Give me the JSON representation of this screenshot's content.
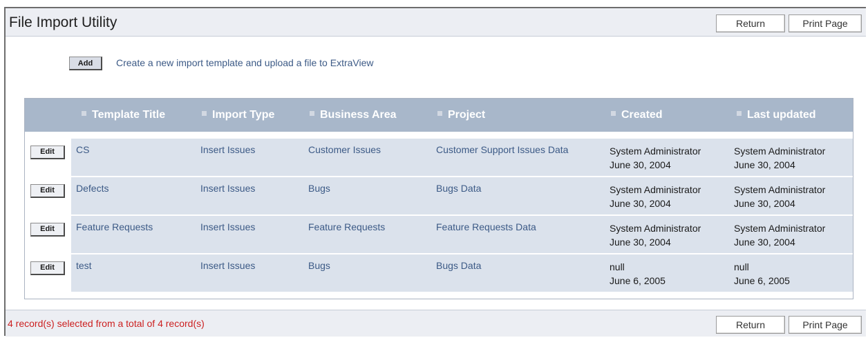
{
  "page": {
    "title": "File Import Utility",
    "return_label": "Return",
    "print_label": "Print Page"
  },
  "add": {
    "button_label": "Add",
    "description": "Create a new import template and upload a file to ExtraView"
  },
  "table": {
    "headers": [
      "Template Title",
      "Import Type",
      "Business Area",
      "Project",
      "Created",
      "Last updated"
    ],
    "edit_label": "Edit",
    "rows": [
      {
        "title": "CS",
        "import_type": "Insert Issues",
        "business_area": "Customer Issues",
        "project": "Customer Support Issues Data",
        "created_by": "System Administrator",
        "created_date": "June 30, 2004",
        "updated_by": "System Administrator",
        "updated_date": "June 30, 2004"
      },
      {
        "title": "Defects",
        "import_type": "Insert Issues",
        "business_area": "Bugs",
        "project": "Bugs Data",
        "created_by": "System Administrator",
        "created_date": "June 30, 2004",
        "updated_by": "System Administrator",
        "updated_date": "June 30, 2004"
      },
      {
        "title": "Feature Requests",
        "import_type": "Insert Issues",
        "business_area": "Feature Requests",
        "project": "Feature Requests Data",
        "created_by": "System Administrator",
        "created_date": "June 30, 2004",
        "updated_by": "System Administrator",
        "updated_date": "June 30, 2004"
      },
      {
        "title": "test",
        "import_type": "Insert Issues",
        "business_area": "Bugs",
        "project": "Bugs Data",
        "created_by": "null",
        "created_date": "June 6, 2005",
        "updated_by": "null",
        "updated_date": "June 6, 2005"
      }
    ]
  },
  "footer": {
    "status": "4 record(s) selected from a total of 4 record(s)",
    "return_label": "Return",
    "print_label": "Print Page"
  },
  "colors": {
    "header_bg": "#a8b7ca",
    "row_bg": "#dbe2ec",
    "link": "#3c5a86",
    "status": "#cc1f1f"
  }
}
